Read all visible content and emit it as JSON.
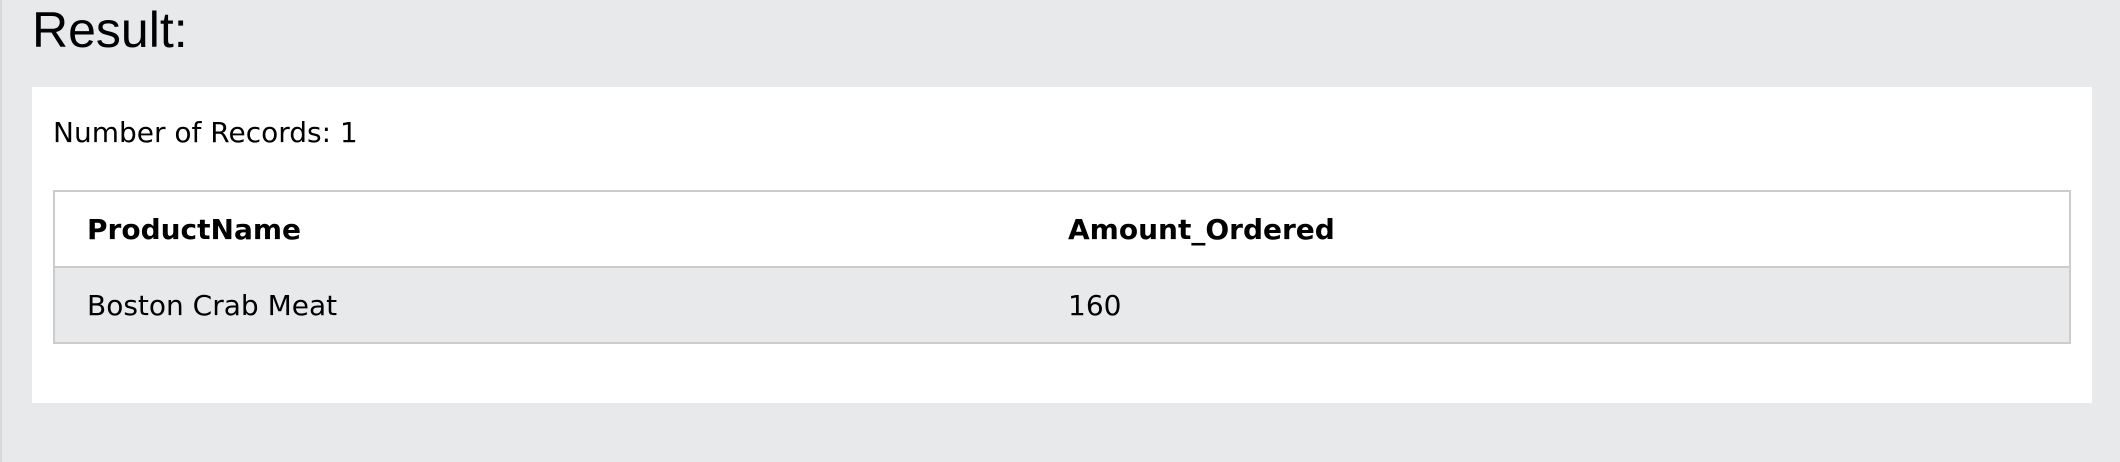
{
  "heading": "Result:",
  "records_label": "Number of Records: 1",
  "table": {
    "columns": [
      "ProductName",
      "Amount_Ordered"
    ],
    "rows": [
      [
        "Boston Crab Meat",
        "160"
      ]
    ]
  },
  "colors": {
    "page_background": "#e7e9eb",
    "panel_background": "#ffffff",
    "row_background": "#e7e9eb",
    "border": "#cccccc"
  }
}
